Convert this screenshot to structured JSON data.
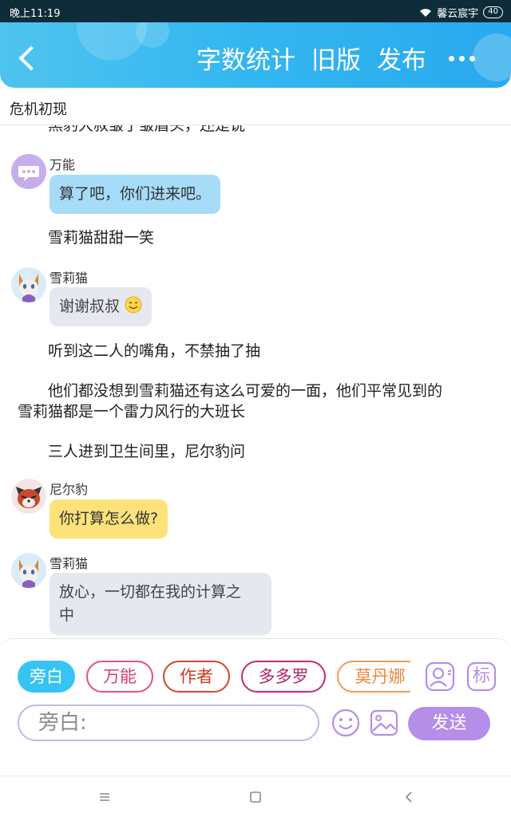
{
  "status": {
    "time": "晚上11:19",
    "carrier": "馨云宸宇",
    "battery": "40"
  },
  "header": {
    "count_label": "字数统计",
    "old_label": "旧版",
    "publish_label": "发布"
  },
  "chapter": {
    "title": "危机初现"
  },
  "messages": {
    "cut_line": "黑豹大叔皱了皱眉头，还是说",
    "m1_speaker": "万能",
    "m1_text": "算了吧，你们进来吧。",
    "n1": "雪莉猫甜甜一笑",
    "m2_speaker": "雪莉猫",
    "m2_text": "谢谢叔叔",
    "n2": "听到这二人的嘴角，不禁抽了抽",
    "n3_line1": "他们都没想到雪莉猫还有这么可爱的一面，他们平常见到的",
    "n3_line2": "雪莉猫都是一个雷力风行的大班长",
    "n4": "三人进到卫生间里，尼尔豹问",
    "m3_speaker": "尼尔豹",
    "m3_text": "你打算怎么做?",
    "m4_speaker": "雪莉猫",
    "m4_text_line1": "放心，一切都在我的计算之",
    "m4_text_line2": "中"
  },
  "tabs": [
    "旁白",
    "万能",
    "作者",
    "多多罗",
    "莫丹娜"
  ],
  "icons": {
    "profile_icon": "person-icon",
    "tag_label": "标"
  },
  "input": {
    "placeholder": "旁白:",
    "send_label": "发送"
  },
  "colors": {
    "header": "#32b6f0",
    "send": "#b58ee8",
    "active_tab": "#38c4f2"
  }
}
